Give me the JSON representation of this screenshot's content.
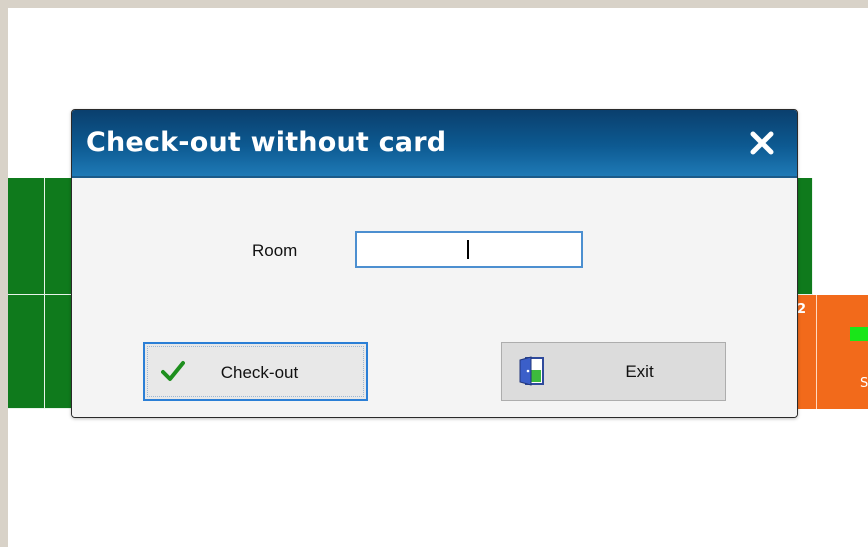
{
  "dialog": {
    "title": "Check-out without card",
    "close_icon": "close-icon",
    "room_label": "Room",
    "room_value": "",
    "checkout_label": "Check-out",
    "checkout_icon": "checkmark-icon",
    "exit_label": "Exit",
    "exit_icon": "door-exit-icon"
  },
  "background_rooms": {
    "partial_number": "2",
    "partial_label": "S"
  },
  "colors": {
    "titlebar": "#0d5a92",
    "room_available": "#0f7a1c",
    "room_occupied": "#f26a1b",
    "status_indicator": "#19e619",
    "focus_border": "#2b7fd6"
  }
}
